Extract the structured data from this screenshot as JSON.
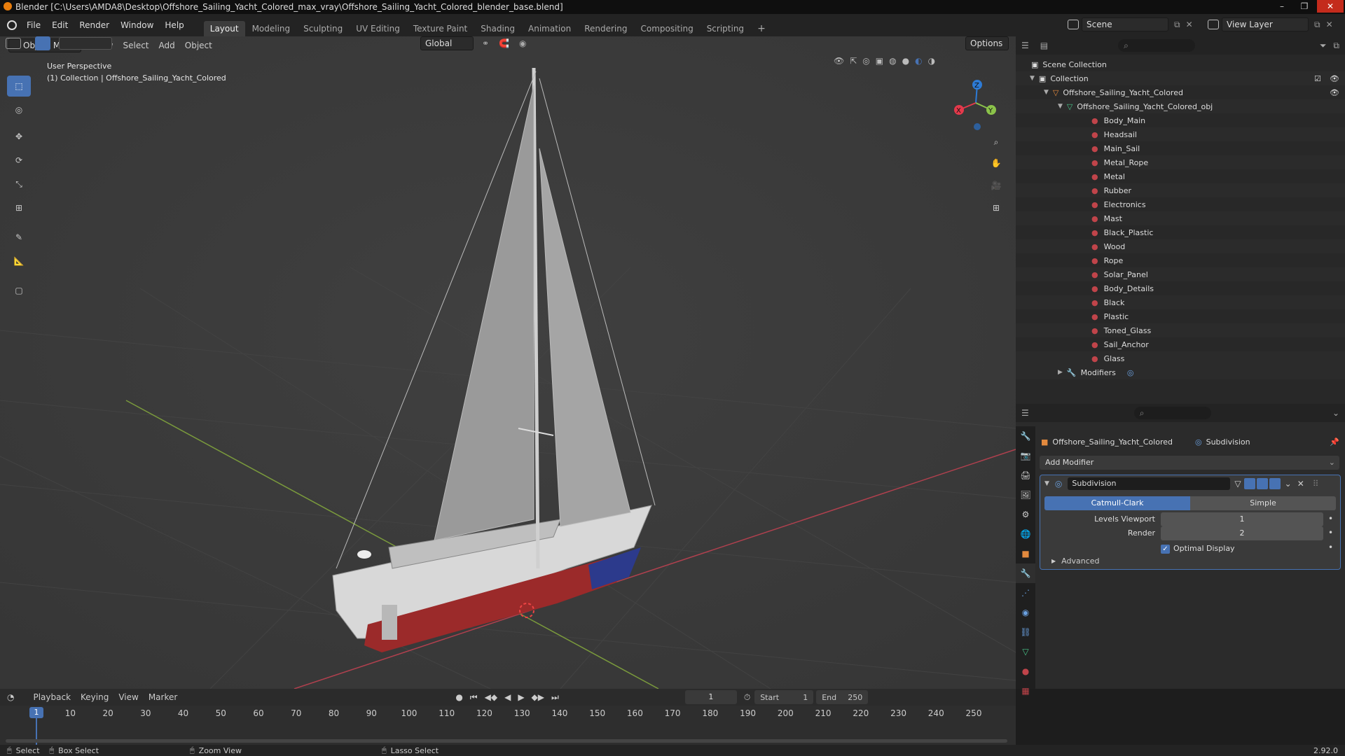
{
  "titlebar": {
    "title": "Blender [C:\\Users\\AMDA8\\Desktop\\Offshore_Sailing_Yacht_Colored_max_vray\\Offshore_Sailing_Yacht_Colored_blender_base.blend]",
    "minimize": "–",
    "maximize": "❐",
    "close": "✕"
  },
  "menus": [
    "File",
    "Edit",
    "Render",
    "Window",
    "Help"
  ],
  "workspaces": [
    "Layout",
    "Modeling",
    "Sculpting",
    "UV Editing",
    "Texture Paint",
    "Shading",
    "Animation",
    "Rendering",
    "Compositing",
    "Scripting",
    "+"
  ],
  "scene": {
    "label": "Scene",
    "view_layer": "View Layer"
  },
  "viewport": {
    "orientation": "Global",
    "options": "Options",
    "mode": "Object Mode",
    "menus": [
      "View",
      "Select",
      "Add",
      "Object"
    ],
    "perspective": "User Perspective",
    "collection_info": "(1) Collection | Offshore_Sailing_Yacht_Colored",
    "gizmo_axes": {
      "x": "X",
      "y": "Y",
      "z": "Z"
    }
  },
  "outliner": {
    "scene_collection": "Scene Collection",
    "collection": "Collection",
    "object": "Offshore_Sailing_Yacht_Colored",
    "mesh": "Offshore_Sailing_Yacht_Colored_obj",
    "materials": [
      "Body_Main",
      "Headsail",
      "Main_Sail",
      "Metal_Rope",
      "Metal",
      "Rubber",
      "Electronics",
      "Mast",
      "Black_Plastic",
      "Wood",
      "Rope",
      "Solar_Panel",
      "Body_Details",
      "Black",
      "Plastic",
      "Toned_Glass",
      "Sail_Anchor",
      "Glass"
    ],
    "modifiers": "Modifiers"
  },
  "properties": {
    "object_name": "Offshore_Sailing_Yacht_Colored",
    "modifier_crumb": "Subdivision",
    "add_modifier": "Add Modifier",
    "modifier_name": "Subdivision",
    "algo_catmull": "Catmull-Clark",
    "algo_simple": "Simple",
    "levels_viewport_label": "Levels Viewport",
    "levels_viewport_value": "1",
    "render_label": "Render",
    "render_value": "2",
    "optimal_display": "Optimal Display",
    "optimal_display_checked": true,
    "advanced": "Advanced"
  },
  "timeline": {
    "menus": [
      "Playback",
      "Keying",
      "View",
      "Marker"
    ],
    "current_frame": "1",
    "start_label": "Start",
    "start_value": "1",
    "end_label": "End",
    "end_value": "250",
    "ticks": [
      "1",
      "10",
      "20",
      "30",
      "40",
      "50",
      "60",
      "70",
      "80",
      "90",
      "100",
      "110",
      "120",
      "130",
      "140",
      "150",
      "160",
      "170",
      "180",
      "190",
      "200",
      "210",
      "220",
      "230",
      "240",
      "250"
    ]
  },
  "statusbar": {
    "select": "Select",
    "box_select": "Box Select",
    "zoom_view": "Zoom View",
    "lasso_select": "Lasso Select",
    "version": "2.92.0"
  },
  "colors": {
    "accent": "#4772b3",
    "axis_x": "#e4394b",
    "axis_y": "#8bc34a",
    "axis_z": "#2d7bd6",
    "material_icon": "#c0444a",
    "object_icon": "#e38a3e",
    "mesh_icon": "#48c488"
  }
}
